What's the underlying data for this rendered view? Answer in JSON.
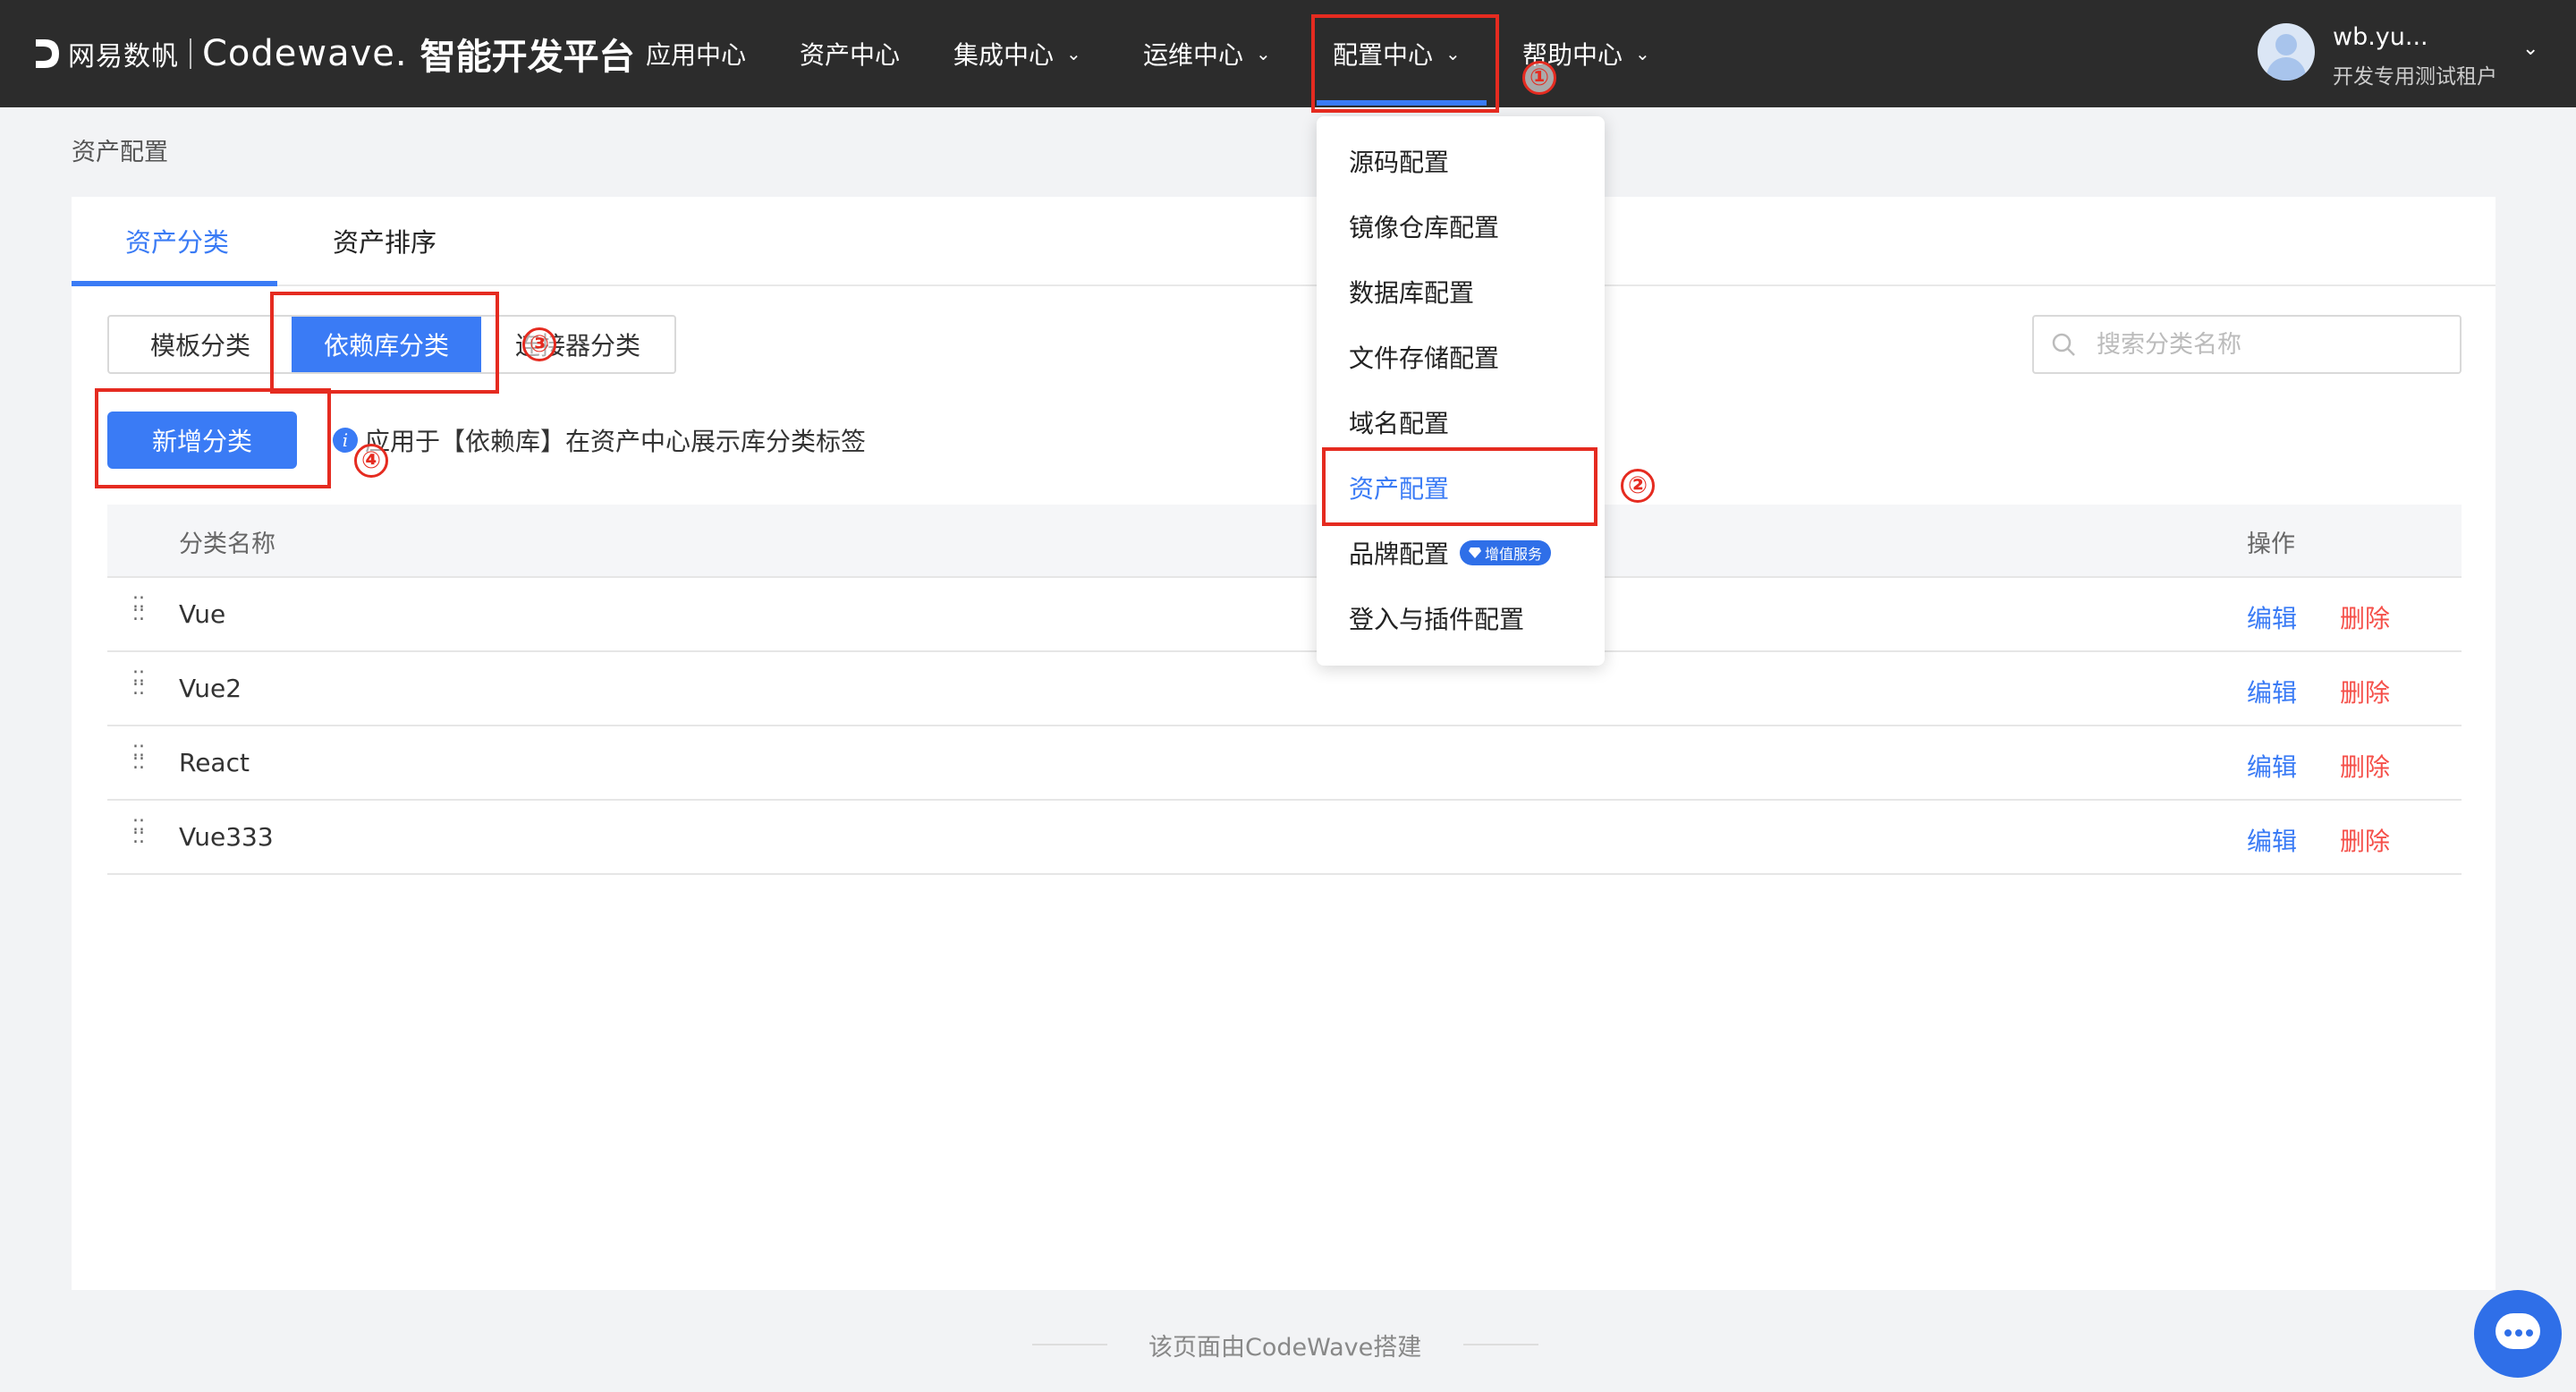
{
  "header": {
    "logo_netease": "网易数帆",
    "logo_codewave": "Codewave.",
    "logo_platform": "智能开发平台",
    "nav": [
      {
        "label": "应用中心",
        "has_dropdown": false
      },
      {
        "label": "资产中心",
        "has_dropdown": false
      },
      {
        "label": "集成中心",
        "has_dropdown": true
      },
      {
        "label": "运维中心",
        "has_dropdown": true
      },
      {
        "label": "配置中心",
        "has_dropdown": true,
        "active": true
      },
      {
        "label": "帮助中心",
        "has_dropdown": true
      }
    ],
    "user": {
      "name": "wb.yu...",
      "tenant": "开发专用测试租户"
    }
  },
  "breadcrumb": "资产配置",
  "tabs": [
    {
      "label": "资产分类",
      "active": true
    },
    {
      "label": "资产排序",
      "active": false
    }
  ],
  "segments": [
    {
      "label": "模板分类",
      "active": false
    },
    {
      "label": "依赖库分类",
      "active": true
    },
    {
      "label": "连接器分类",
      "active": false
    }
  ],
  "search": {
    "placeholder": "搜索分类名称",
    "value": ""
  },
  "add_button": "新增分类",
  "info_text": "应用于【依赖库】在资产中心展示库分类标签",
  "table": {
    "columns": [
      "分类名称",
      "操作"
    ],
    "rows": [
      {
        "name": "Vue"
      },
      {
        "name": "Vue2"
      },
      {
        "name": "React"
      },
      {
        "name": "Vue333"
      }
    ],
    "edit_label": "编辑",
    "delete_label": "删除"
  },
  "dropdown": {
    "items": [
      {
        "label": "源码配置"
      },
      {
        "label": "镜像仓库配置"
      },
      {
        "label": "数据库配置"
      },
      {
        "label": "文件存储配置"
      },
      {
        "label": "域名配置"
      },
      {
        "label": "资产配置",
        "active": true
      },
      {
        "label": "品牌配置",
        "badge": "增值服务"
      },
      {
        "label": "登入与插件配置"
      }
    ]
  },
  "annotations": [
    "①",
    "②",
    "③",
    "④"
  ],
  "footer": "该页面由CodeWave搭建",
  "colors": {
    "accent": "#3a7bf5",
    "danger": "#f5504a",
    "annotation": "#e52b20",
    "topbar": "#2c2c2c"
  },
  "icons": {
    "search": "search-icon",
    "info": "info-icon",
    "drag": "drag-handle-icon",
    "chat": "chat-icon",
    "chevron": "chevron-down-icon"
  }
}
